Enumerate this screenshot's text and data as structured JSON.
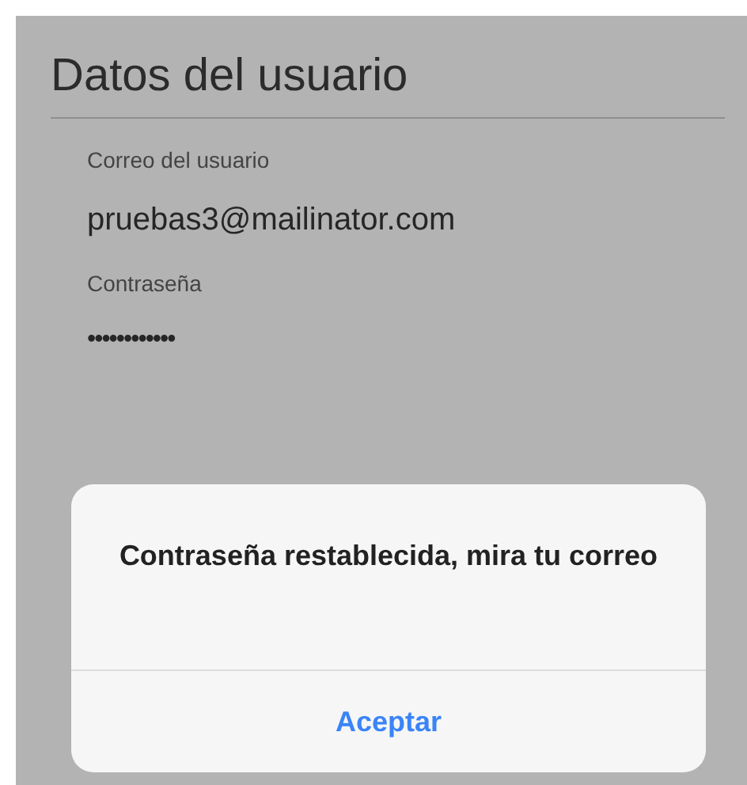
{
  "screen": {
    "title": "Datos del usuario"
  },
  "fields": [
    {
      "label": "Correo del usuario",
      "value": "pruebas3@mailinator.com"
    },
    {
      "label": "Contraseña",
      "value": "••••••••••••"
    }
  ],
  "dialog": {
    "message": "Contraseña restablecida, mira tu correo",
    "button": "Aceptar"
  }
}
